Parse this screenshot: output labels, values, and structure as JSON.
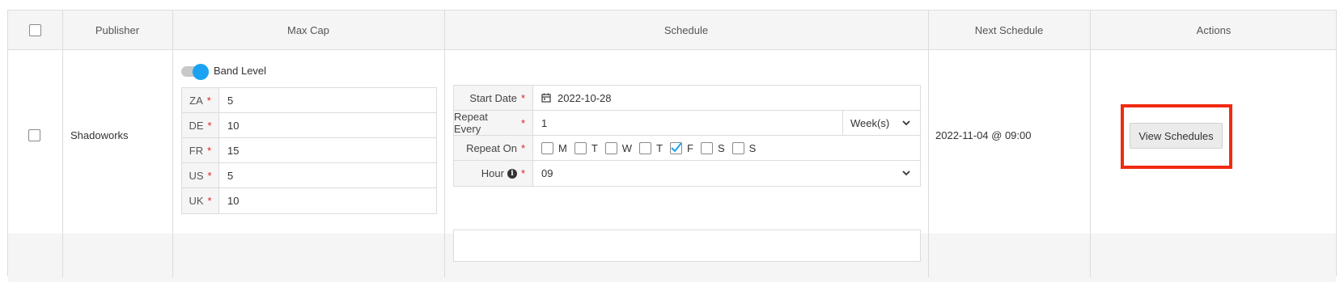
{
  "header": {
    "publisher": "Publisher",
    "max_cap": "Max Cap",
    "schedule": "Schedule",
    "next_schedule": "Next Schedule",
    "actions": "Actions"
  },
  "row": {
    "publisher": "Shadoworks",
    "band_level_label": "Band Level",
    "band_level_on": true,
    "caps": [
      {
        "key": "ZA",
        "value": "5"
      },
      {
        "key": "DE",
        "value": "10"
      },
      {
        "key": "FR",
        "value": "15"
      },
      {
        "key": "US",
        "value": "5"
      },
      {
        "key": "UK",
        "value": "10"
      }
    ],
    "schedule": {
      "start_date_label": "Start Date",
      "start_date": "2022-10-28",
      "repeat_every_label": "Repeat Every",
      "repeat_every": "1",
      "repeat_unit": "Week(s)",
      "repeat_on_label": "Repeat On",
      "days": [
        {
          "label": "M",
          "checked": false
        },
        {
          "label": "T",
          "checked": false
        },
        {
          "label": "W",
          "checked": false
        },
        {
          "label": "T",
          "checked": false
        },
        {
          "label": "F",
          "checked": true
        },
        {
          "label": "S",
          "checked": false
        },
        {
          "label": "S",
          "checked": false
        }
      ],
      "hour_label": "Hour",
      "hour": "09"
    },
    "next_schedule": "2022-11-04 @ 09:00",
    "action_label": "View Schedules"
  },
  "colors": {
    "accent": "#1aa3f2",
    "required": "#e02020",
    "highlight": "#f02b12"
  }
}
